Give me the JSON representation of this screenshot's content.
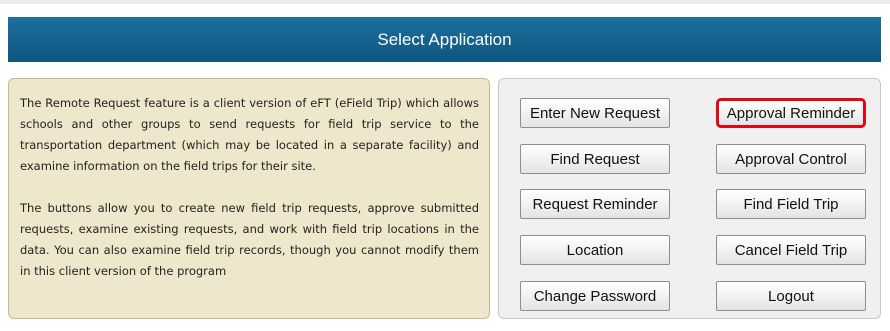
{
  "header": {
    "title": "Select Application"
  },
  "info": {
    "paragraph1": "The Remote Request feature is a client version of eFT (eField Trip) which allows schools and other groups to send requests for field trip service to the transportation department (which may be located in a separate facility) and examine information on the field trips for their site.",
    "paragraph2": "The buttons allow you to create new field trip requests, approve submitted requests, examine existing requests, and work with field trip locations in the data. You can also examine field trip records, though you cannot modify them in this client version of the program"
  },
  "buttons": {
    "enter_new_request": "Enter New Request",
    "approval_reminder": "Approval Reminder",
    "find_request": "Find Request",
    "approval_control": "Approval Control",
    "request_reminder": "Request Reminder",
    "find_field_trip": "Find Field Trip",
    "location": "Location",
    "cancel_field_trip": "Cancel Field Trip",
    "change_password": "Change Password",
    "logout": "Logout"
  },
  "colors": {
    "header_bg": "#0f5680",
    "info_panel_bg": "#efe7cc",
    "highlight_border": "#e30613"
  }
}
